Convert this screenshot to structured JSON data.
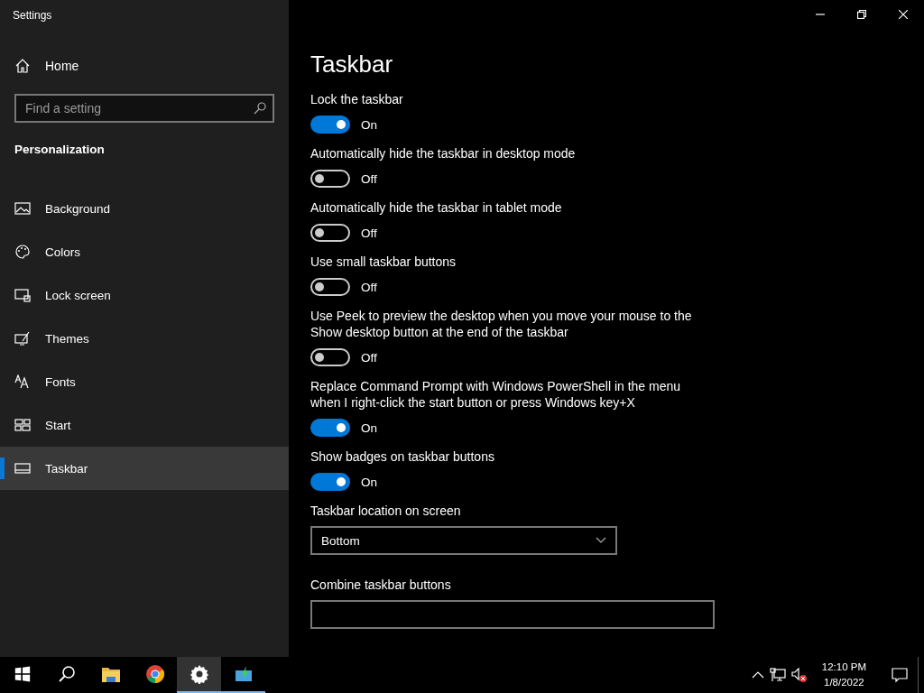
{
  "window": {
    "title": "Settings"
  },
  "sidebar": {
    "home": "Home",
    "search": {
      "placeholder": "Find a setting"
    },
    "section": "Personalization",
    "items": [
      {
        "label": "Background",
        "kind": "background",
        "selected": false
      },
      {
        "label": "Colors",
        "kind": "colors",
        "selected": false
      },
      {
        "label": "Lock screen",
        "kind": "lock",
        "selected": false
      },
      {
        "label": "Themes",
        "kind": "themes",
        "selected": false
      },
      {
        "label": "Fonts",
        "kind": "fonts",
        "selected": false
      },
      {
        "label": "Start",
        "kind": "start",
        "selected": false
      },
      {
        "label": "Taskbar",
        "kind": "taskbar",
        "selected": true
      }
    ]
  },
  "page": {
    "title": "Taskbar",
    "settings": [
      {
        "label": "Lock the taskbar",
        "on": true,
        "state": "On"
      },
      {
        "label": "Automatically hide the taskbar in desktop mode",
        "on": false,
        "state": "Off"
      },
      {
        "label": "Automatically hide the taskbar in tablet mode",
        "on": false,
        "state": "Off"
      },
      {
        "label": "Use small taskbar buttons",
        "on": false,
        "state": "Off"
      },
      {
        "label": "Use Peek to preview the desktop when you move your mouse to the Show desktop button at the end of the taskbar",
        "on": false,
        "state": "Off"
      },
      {
        "label": "Replace Command Prompt with Windows PowerShell in the menu when I right-click the start button or press Windows key+X",
        "on": true,
        "state": "On"
      },
      {
        "label": "Show badges on taskbar buttons",
        "on": true,
        "state": "On"
      }
    ],
    "location": {
      "label": "Taskbar location on screen",
      "value": "Bottom"
    },
    "combine": {
      "label": "Combine taskbar buttons"
    }
  },
  "taskbar": {
    "apps": [
      {
        "kind": "start",
        "selected": false,
        "running": false
      },
      {
        "kind": "search",
        "selected": false,
        "running": false
      },
      {
        "kind": "explorer",
        "selected": false,
        "running": false
      },
      {
        "kind": "chrome",
        "selected": false,
        "running": false
      },
      {
        "kind": "settings",
        "selected": true,
        "running": true
      },
      {
        "kind": "app",
        "selected": false,
        "running": true
      }
    ],
    "time": "12:10 PM",
    "date": "1/8/2022"
  }
}
